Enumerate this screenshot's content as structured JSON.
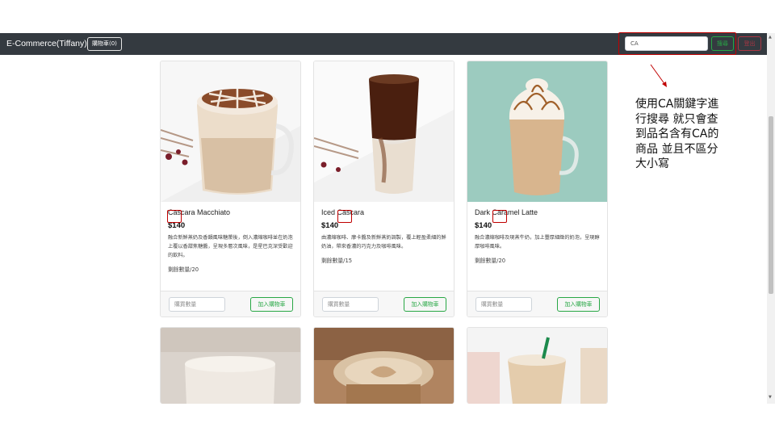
{
  "navbar": {
    "brand": "E-Commerce(Tiffany)",
    "cart_label": "購物車(0)",
    "search_value": "CA",
    "search_button": "搜尋",
    "logout_button": "登出"
  },
  "products": [
    {
      "name": "Cascara Macchiato",
      "price": "$140",
      "description": "融合新鮮蒸奶及香韻風味糖漿後，倒入濃縮咖啡並在奶泡上覆以香甜焦糖醬，呈現多層次風味，是星巴克深受歡迎的飲料。",
      "stock": "剩餘數量/20",
      "qty_placeholder": "購買數量",
      "add_label": "加入購物車"
    },
    {
      "name": "Iced Cascara",
      "price": "$140",
      "description": "由濃縮咖啡、摩卡醬及新鮮蒸奶調製，覆上輕盈柔細的鮮奶油，帶來香濃的巧克力及咖啡風味。",
      "stock": "剩餘數量/15",
      "qty_placeholder": "購買數量",
      "add_label": "加入購物車"
    },
    {
      "name": "Dark Caramel Latte",
      "price": "$140",
      "description": "融合濃縮咖啡及現蒸牛奶，加上豐厚細緻的奶泡，呈現醇厚咖啡風味。",
      "stock": "剩餘數量/20",
      "qty_placeholder": "購買數量",
      "add_label": "加入購物車"
    }
  ],
  "annotation": {
    "lines": [
      "使用CA關鍵字進",
      "行搜尋 就只會查",
      "到品名含有CA的",
      "商品 並且不區分",
      "大小寫"
    ]
  },
  "colors": {
    "navbar": "#343a40",
    "success": "#28a745",
    "danger": "#dc3545",
    "highlight": "#c00000",
    "mint_bg": "#9ccbbf"
  }
}
